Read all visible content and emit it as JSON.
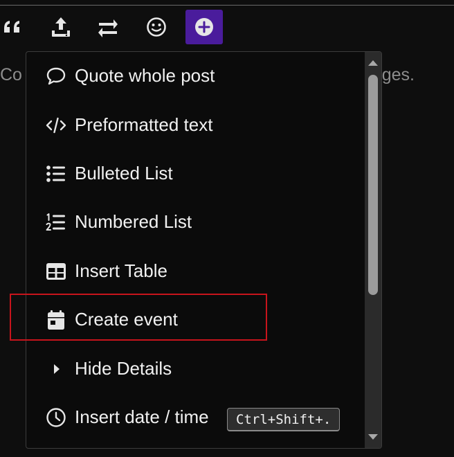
{
  "composer": {
    "placeholder_left": "Co",
    "placeholder_right": "ges."
  },
  "toolbar": {
    "buttons": [
      {
        "icon": "quote-icon"
      },
      {
        "icon": "upload-icon"
      },
      {
        "icon": "toggle-preview-icon"
      },
      {
        "icon": "emoji-icon"
      },
      {
        "icon": "plus-circle-icon",
        "active": true
      }
    ],
    "active_color": "#4a1c9c"
  },
  "popup_menu": {
    "items": [
      {
        "label": "Quote whole post",
        "icon": "speech-bubble-icon"
      },
      {
        "label": "Preformatted text",
        "icon": "code-icon"
      },
      {
        "label": "Bulleted List",
        "icon": "bulleted-list-icon"
      },
      {
        "label": "Numbered List",
        "icon": "numbered-list-icon"
      },
      {
        "label": "Insert Table",
        "icon": "table-icon"
      },
      {
        "label": "Create event",
        "icon": "calendar-icon",
        "highlighted": true
      },
      {
        "label": "Hide Details",
        "icon": "caret-right-icon"
      },
      {
        "label": "Insert date / time",
        "icon": "clock-icon",
        "shortcut": "Ctrl+Shift+."
      }
    ],
    "highlight_color": "#c8141c"
  }
}
